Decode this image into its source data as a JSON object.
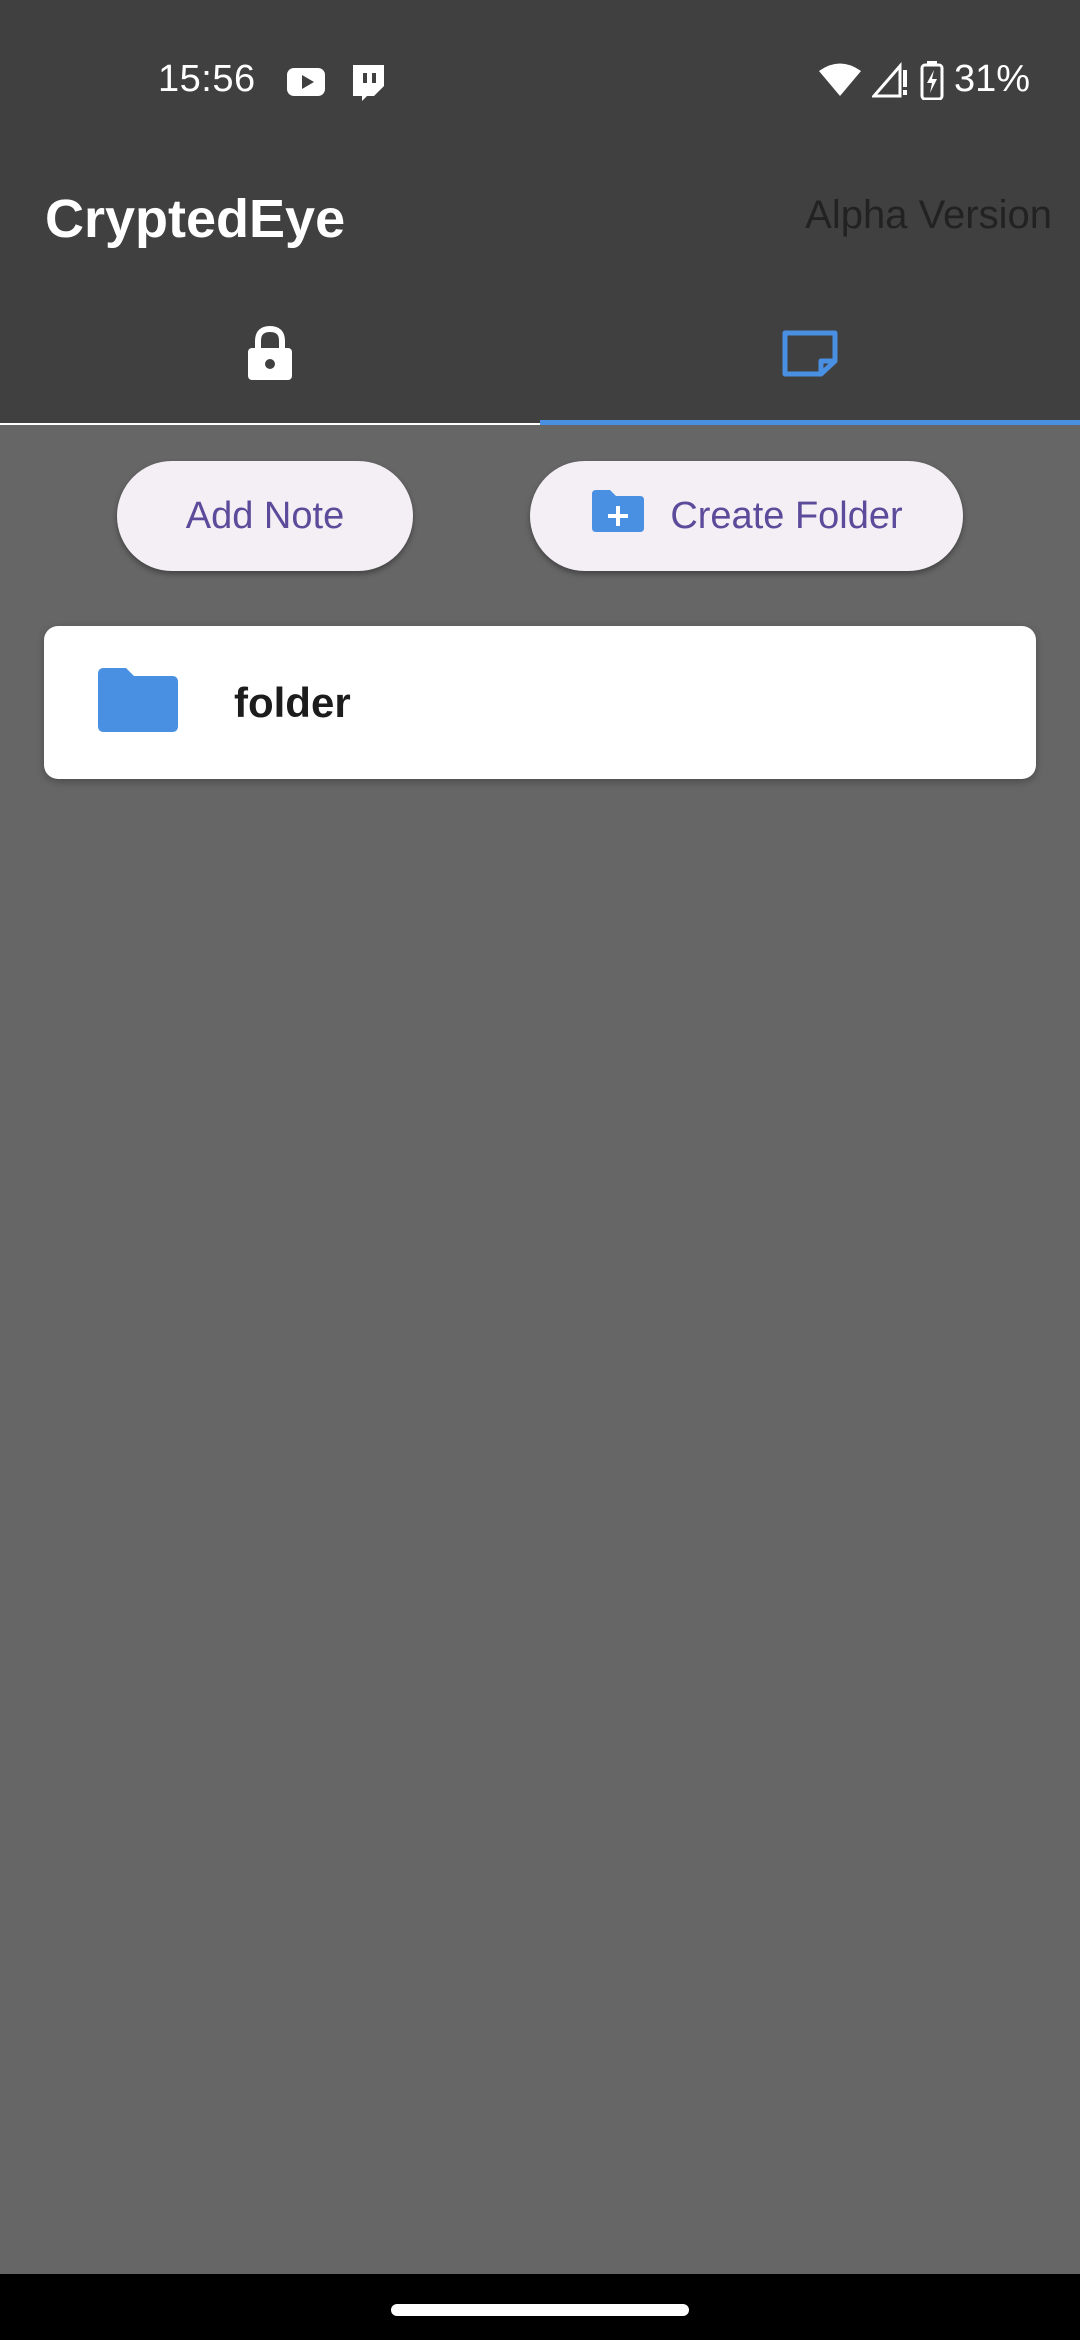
{
  "status_bar": {
    "time": "15:56",
    "notification_icons": [
      "youtube-icon",
      "twitch-icon"
    ],
    "battery": "31%",
    "icons": [
      "wifi-icon",
      "cell-signal-icon",
      "battery-charging-icon"
    ]
  },
  "app_bar": {
    "title": "CryptedEye",
    "subtitle": "Alpha Version",
    "background": "#404040"
  },
  "tabs": [
    {
      "icon": "lock-icon",
      "active": false
    },
    {
      "icon": "note-icon",
      "active": true
    }
  ],
  "actions": {
    "add_note_label": "Add Note",
    "create_folder_label": "Create Folder",
    "create_folder_icon": "create-folder-icon"
  },
  "folders": [
    {
      "name": "folder",
      "icon": "folder-icon"
    }
  ],
  "colors": {
    "accent": "#4a90e2",
    "button_text": "#5b4b9a",
    "button_bg": "#f4eef5",
    "content_bg": "#666666"
  }
}
